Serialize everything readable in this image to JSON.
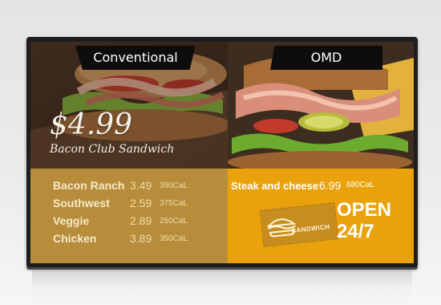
{
  "tabs": {
    "conventional": "Conventional",
    "omd": "OMD"
  },
  "featured": {
    "price": "$4.99",
    "name": "Bacon Club Sandwich"
  },
  "menu": [
    {
      "name": "Bacon Ranch",
      "price": "3.49",
      "cal": "390CaL"
    },
    {
      "name": "Southwest",
      "price": "2.59",
      "cal": "375CaL"
    },
    {
      "name": "Veggie",
      "price": "2.89",
      "cal": "250CaL"
    },
    {
      "name": "Chicken",
      "price": "3.89",
      "cal": "350CaL"
    }
  ],
  "omd_promo": {
    "item": "Steak and cheese",
    "price": "6.99",
    "cal": "680CaL",
    "stamp_label": "SANDWICH",
    "open_line1": "OPEN",
    "open_line2": "24/7"
  },
  "colors": {
    "left_menu_bg": "#b48732",
    "right_menu_bg": "#e9a20b",
    "tab_bg": "#0d0d0d"
  }
}
